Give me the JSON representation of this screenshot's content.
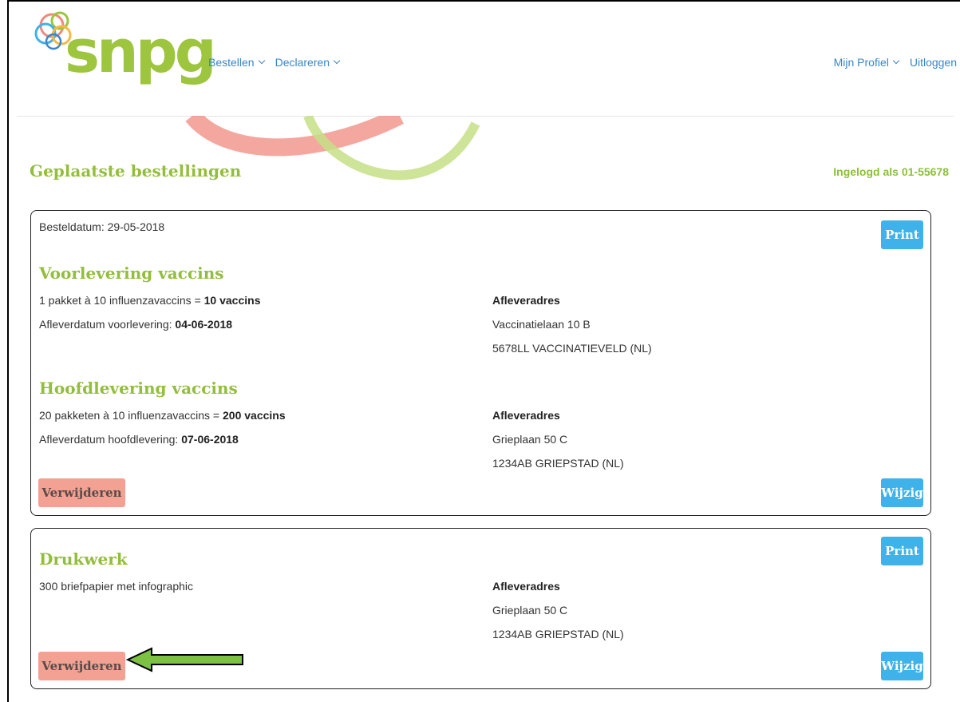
{
  "brand": {
    "name": "snpg",
    "color": "#9dc53e"
  },
  "nav": {
    "left": [
      {
        "label": "Bestellen"
      },
      {
        "label": "Declareren"
      }
    ],
    "right": [
      {
        "label": "Mijn Profiel"
      },
      {
        "label": "Uitloggen"
      }
    ]
  },
  "page": {
    "title": "Geplaatste bestellingen",
    "logged_in": "Ingelogd als 01-55678"
  },
  "orders": [
    {
      "date_label": "Besteldatum: 29-05-2018",
      "print_label": "Print",
      "sections": [
        {
          "title": "Voorlevering vaccins",
          "qty_prefix": "1 pakket à 10 influenzavaccins = ",
          "qty_total": "10 vaccins",
          "delivery_prefix": "Afleverdatum voorlevering: ",
          "delivery_date": "04-06-2018",
          "address_heading": "Afleveradres",
          "address_line1": "Vaccinatielaan 10 B",
          "address_line2": "5678LL VACCINATIEVELD (NL)"
        },
        {
          "title": "Hoofdlevering vaccins",
          "qty_prefix": "20 pakketen à 10 influenzavaccins = ",
          "qty_total": "200 vaccins",
          "delivery_prefix": "Afleverdatum hoofdlevering: ",
          "delivery_date": "07-06-2018",
          "address_heading": "Afleveradres",
          "address_line1": "Grieplaan 50 C",
          "address_line2": "1234AB GRIEPSTAD (NL)"
        }
      ],
      "delete_label": "Verwijderen",
      "edit_label": "Wijzig"
    },
    {
      "print_label": "Print",
      "title": "Drukwerk",
      "description": "300 briefpapier met infographic",
      "address_heading": "Afleveradres",
      "address_line1": "Grieplaan 50 C",
      "address_line2": "1234AB GRIEPSTAD (NL)",
      "delete_label": "Verwijderen",
      "edit_label": "Wijzig"
    }
  ],
  "colors": {
    "accent_green": "#93be3c",
    "link_blue": "#3a86c8",
    "button_blue": "#3eb2e9",
    "button_red": "#f3a192",
    "annotation_arrow": "#7cc142"
  },
  "annotation": {
    "icon": "left-arrow-icon",
    "points_to": "Verwijderen"
  }
}
